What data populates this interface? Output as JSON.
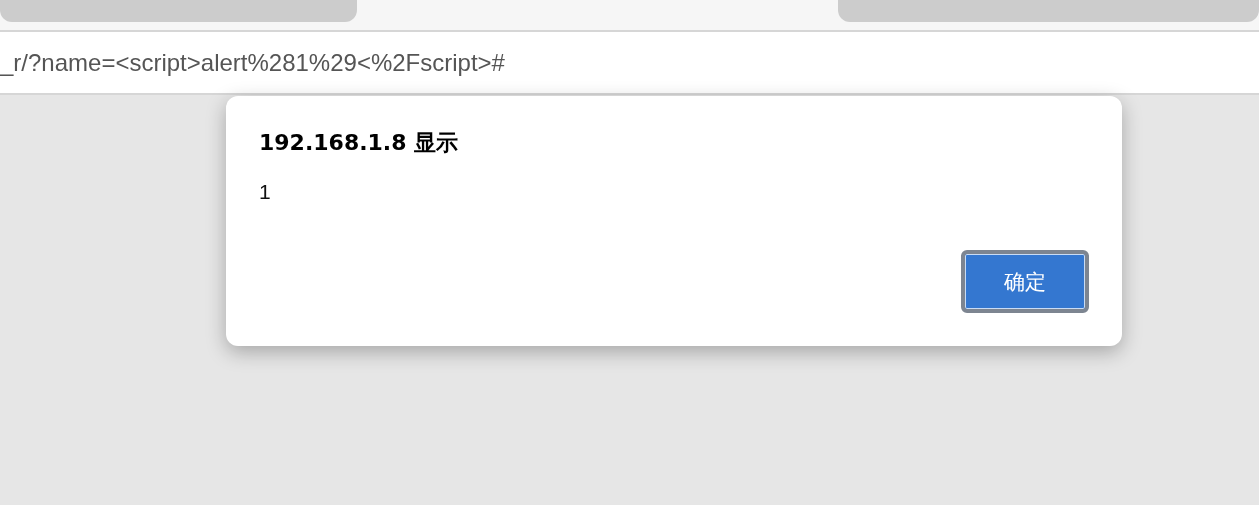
{
  "address_bar": {
    "url": "_r/?name=<script>alert%281%29<%2Fscript>#"
  },
  "dialog": {
    "title": "192.168.1.8 显示",
    "message": "1",
    "buttons": [
      "确定"
    ]
  }
}
